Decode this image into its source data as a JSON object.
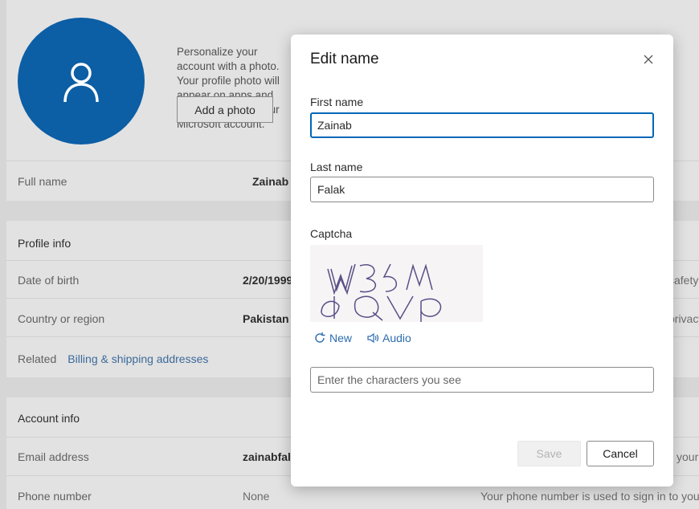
{
  "profile": {
    "personalize_text": "Personalize your account with a photo. Your profile photo will appear on apps and devices that use your Microsoft account.",
    "add_photo_label": "Add a photo",
    "full_name_label": "Full name",
    "full_name_value": "Zainab Falak"
  },
  "profile_info": {
    "heading": "Profile info",
    "dob_label": "Date of birth",
    "dob_value": "2/20/1999",
    "dob_note": "safety",
    "country_label": "Country or region",
    "country_value": "Pakistan",
    "country_note": "privacy",
    "related_label": "Related",
    "billing_link": "Billing & shipping addresses"
  },
  "account_info": {
    "heading": "Account info",
    "email_label": "Email address",
    "email_value": "zainabfalak",
    "email_note": "your",
    "phone_label": "Phone number",
    "phone_value": "None",
    "phone_note": "Your phone number is used to sign in to you"
  },
  "dialog": {
    "title": "Edit name",
    "first_name_label": "First name",
    "first_name_value": "Zainab",
    "last_name_label": "Last name",
    "last_name_value": "Falak",
    "captcha_label": "Captcha",
    "captcha_text": "W35W bQVP",
    "new_label": "New",
    "audio_label": "Audio",
    "captcha_placeholder": "Enter the characters you see",
    "save_label": "Save",
    "cancel_label": "Cancel"
  },
  "icons": {
    "avatar": "person-icon",
    "close": "close-icon",
    "refresh": "refresh-icon",
    "audio": "speaker-icon"
  },
  "colors": {
    "accent": "#0067b8",
    "avatar_bg": "#0c5ea5",
    "link": "#2c6cb0"
  }
}
